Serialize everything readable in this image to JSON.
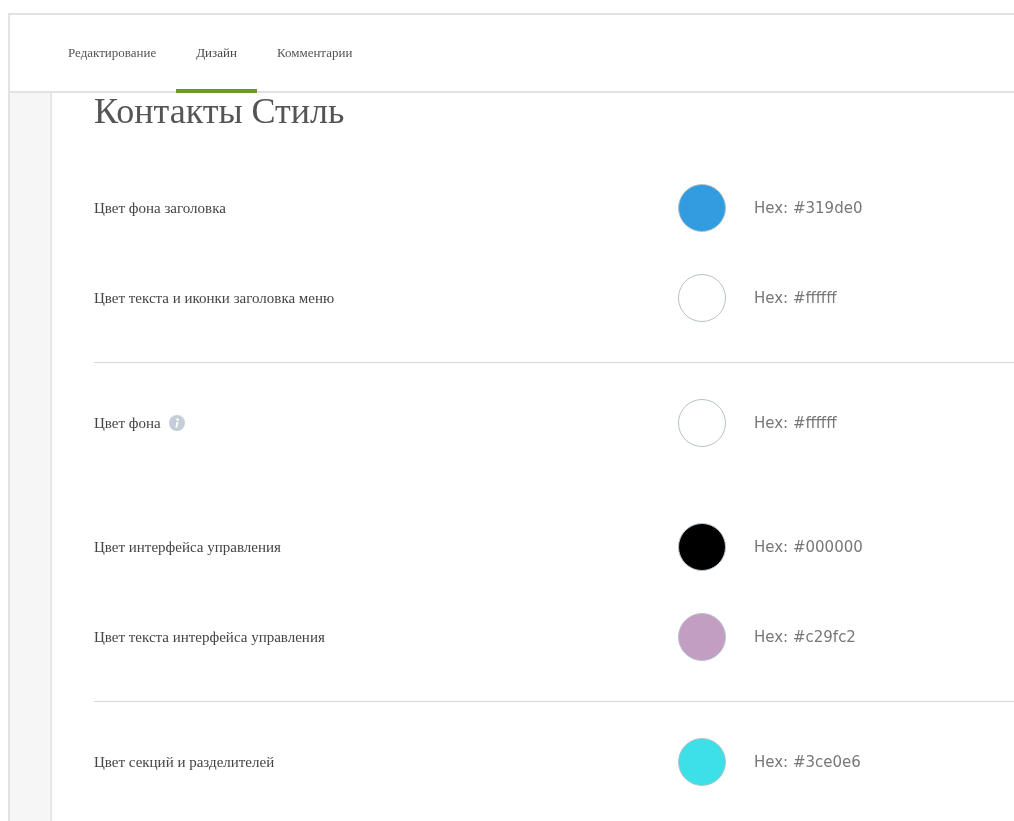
{
  "tabs": [
    {
      "label": "Редактирование",
      "selected": false
    },
    {
      "label": "Дизайн",
      "selected": true
    },
    {
      "label": "Комментарии",
      "selected": false
    }
  ],
  "title": "Контакты Стиль",
  "groups": [
    {
      "divider": true,
      "rows": [
        {
          "label": "Цвет фона заголовка",
          "info": false,
          "color": "#319de0",
          "hex": "Hex: #319de0"
        },
        {
          "label": "Цвет текста и иконки заголовка меню",
          "info": false,
          "color": "#ffffff",
          "hex": "Hex: #ffffff"
        }
      ]
    },
    {
      "divider": false,
      "rows": [
        {
          "label": "Цвет фона",
          "info": true,
          "color": "#ffffff",
          "hex": "Hex: #ffffff"
        }
      ]
    },
    {
      "divider": true,
      "rows": [
        {
          "label": "Цвет интерфейса управления",
          "info": false,
          "color": "#000000",
          "hex": "Hex: #000000"
        },
        {
          "label": "Цвет текста интерфейса управления",
          "info": false,
          "color": "#c29fc2",
          "hex": "Hex: #c29fc2"
        }
      ]
    },
    {
      "divider": false,
      "rows": [
        {
          "label": "Цвет секций и разделителей",
          "info": false,
          "color": "#3ce0e6",
          "hex": "Hex: #3ce0e6"
        }
      ]
    }
  ]
}
